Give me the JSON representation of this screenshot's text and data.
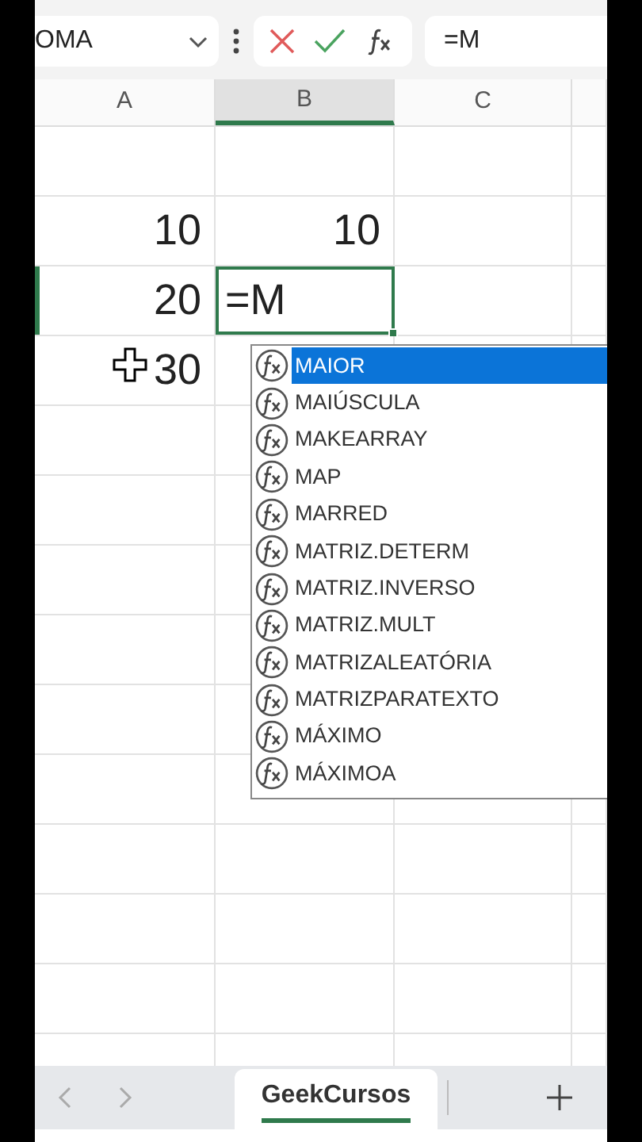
{
  "name_box": {
    "value": "OMA"
  },
  "formula_bar": {
    "value": "=M"
  },
  "columns": [
    {
      "label": "A",
      "selected": false
    },
    {
      "label": "B",
      "selected": true
    },
    {
      "label": "C",
      "selected": false
    }
  ],
  "rows": [
    {
      "A": "10",
      "B": "10",
      "selected": false
    },
    {
      "A": "20",
      "B": "=M",
      "selected": true
    },
    {
      "A": "30",
      "selected": false
    }
  ],
  "autocomplete": {
    "items": [
      {
        "label": "MAIOR",
        "selected": true
      },
      {
        "label": "MAIÚSCULA",
        "selected": false
      },
      {
        "label": "MAKEARRAY",
        "selected": false
      },
      {
        "label": "MAP",
        "selected": false
      },
      {
        "label": "MARRED",
        "selected": false
      },
      {
        "label": "MATRIZ.DETERM",
        "selected": false
      },
      {
        "label": "MATRIZ.INVERSO",
        "selected": false
      },
      {
        "label": "MATRIZ.MULT",
        "selected": false
      },
      {
        "label": "MATRIZALEATÓRIA",
        "selected": false
      },
      {
        "label": "MATRIZPARATEXTO",
        "selected": false
      },
      {
        "label": "MÁXIMO",
        "selected": false
      },
      {
        "label": "MÁXIMOA",
        "selected": false
      }
    ]
  },
  "sheet_tabs": [
    {
      "label": "GeekCursos",
      "selected": true
    }
  ]
}
